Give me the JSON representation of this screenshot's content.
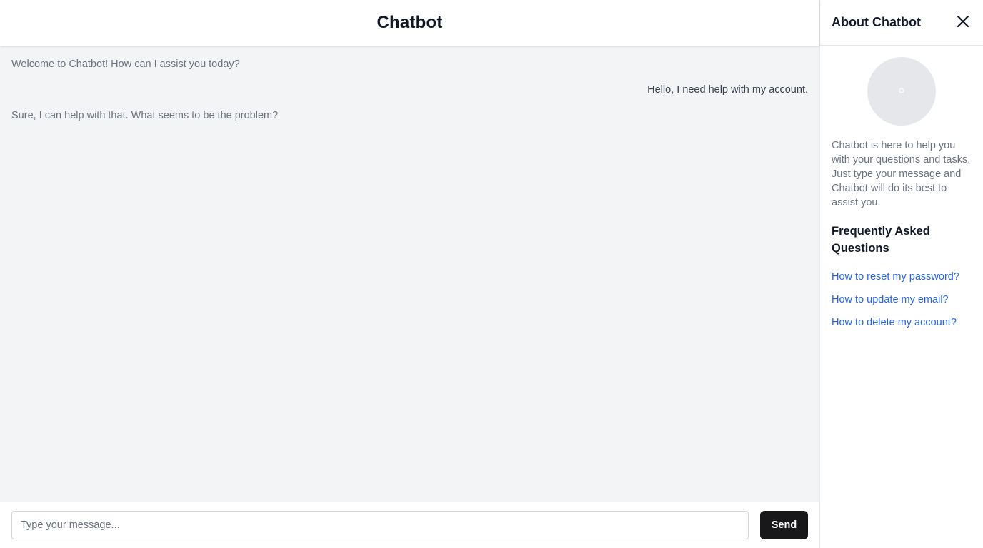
{
  "header": {
    "title": "Chatbot"
  },
  "messages": [
    {
      "role": "bot",
      "text": "Welcome to Chatbot! How can I assist you today?"
    },
    {
      "role": "user",
      "text": "Hello, I need help with my account."
    },
    {
      "role": "bot",
      "text": "Sure, I can help with that. What seems to be the problem?"
    }
  ],
  "composer": {
    "placeholder": "Type your message...",
    "value": "",
    "send_label": "Send"
  },
  "sidebar": {
    "title": "About Chatbot",
    "close_icon": "close-icon",
    "avatar_icon": "avatar-placeholder-icon",
    "description": "Chatbot is here to help you with your questions and tasks. Just type your message and Chatbot will do its best to assist you.",
    "faq_title": "Frequently Asked Questions",
    "faq": [
      {
        "label": "How to reset my password?"
      },
      {
        "label": "How to update my email?"
      },
      {
        "label": "How to delete my account?"
      }
    ]
  },
  "colors": {
    "accent_link": "#2563eb",
    "send_button": "#18181b",
    "chat_background": "#f3f4f6"
  }
}
